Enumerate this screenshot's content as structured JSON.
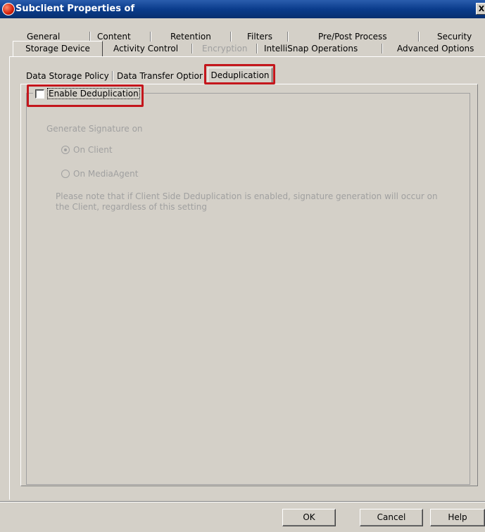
{
  "window": {
    "title": "Subclient Properties of",
    "close_glyph": "X"
  },
  "top_tabs_row1": [
    "General",
    "Content",
    "Retention",
    "Filters",
    "Pre/Post Process",
    "Security"
  ],
  "top_tabs_row2": [
    "Storage Device",
    "Activity Control",
    "Encryption",
    "IntelliSnap Operations",
    "Advanced Options"
  ],
  "inner_tabs": [
    "Data Storage Policy",
    "Data Transfer Option",
    "Deduplication"
  ],
  "dedup": {
    "enable_label": "Enable Deduplication",
    "enabled": false,
    "signature_heading": "Generate Signature on",
    "options": [
      "On Client",
      "On MediaAgent"
    ],
    "selected_option": "On Client",
    "note": "Please note that if Client Side Deduplication is enabled, signature generation will occur on the Client, regardless of this setting"
  },
  "buttons": {
    "ok": "OK",
    "cancel": "Cancel",
    "help": "Help"
  },
  "colors": {
    "titlebar": "#0a3c8c",
    "highlight": "#c4161c",
    "dialog_bg": "#d4d0c8",
    "disabled_text": "#a0a0a0"
  },
  "icons": {
    "app": "commvault-logo-icon",
    "close": "close-icon"
  }
}
